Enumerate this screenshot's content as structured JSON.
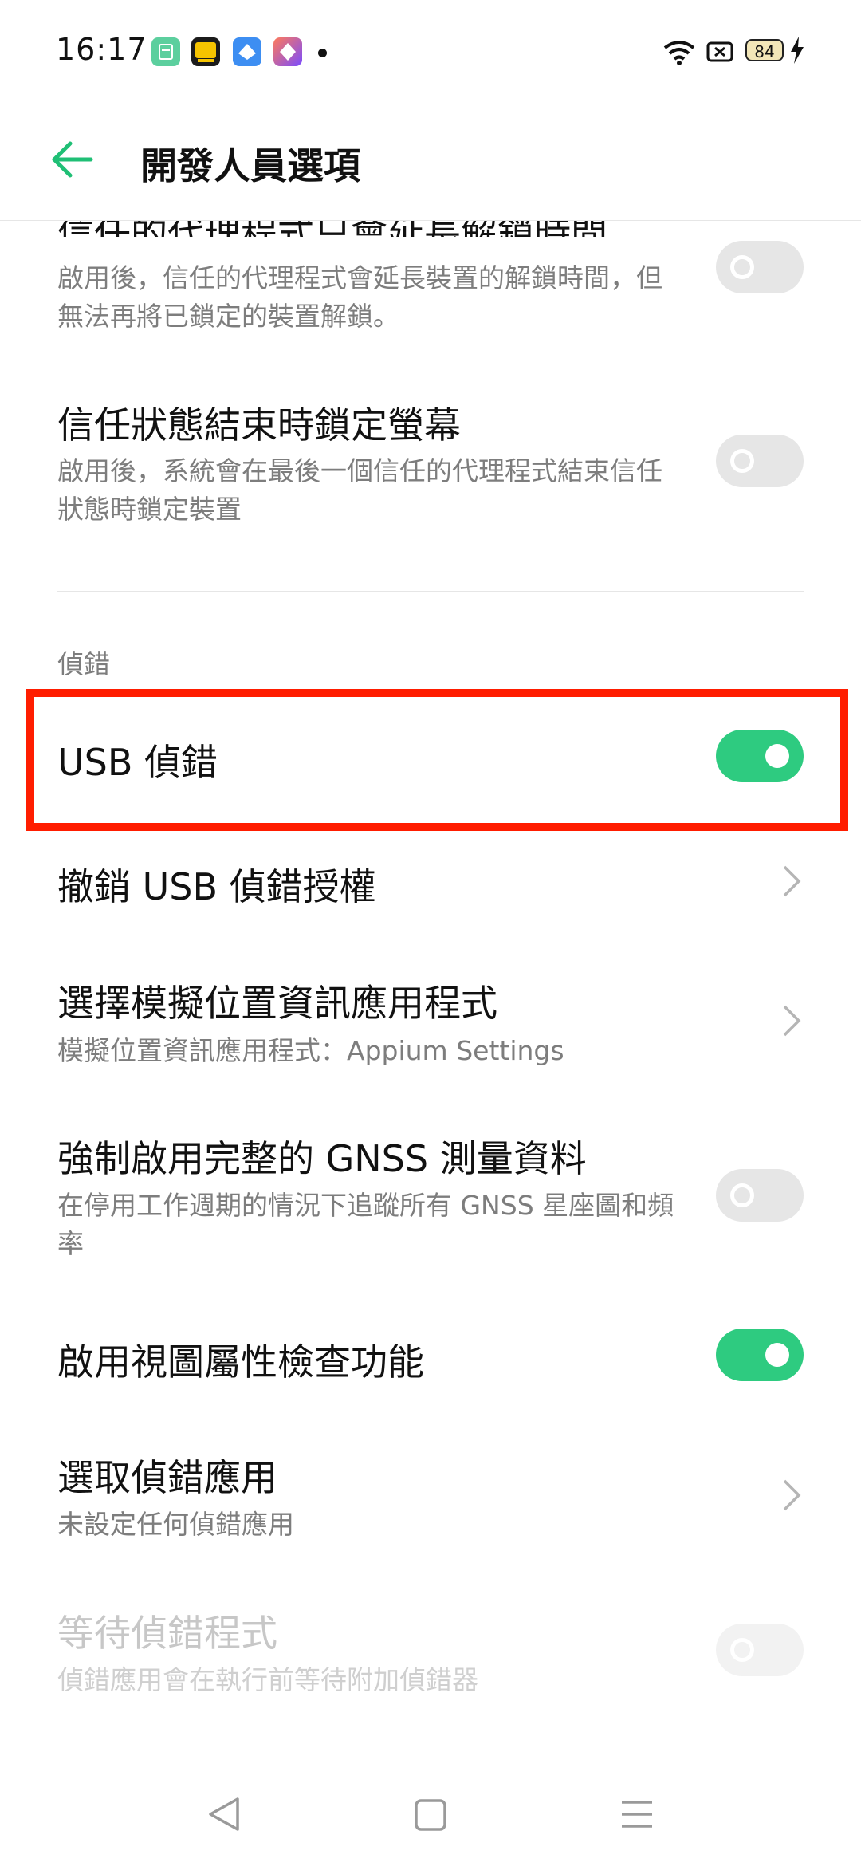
{
  "status_bar": {
    "time": "16:17",
    "battery_level": "84",
    "icons": [
      "app-icon-green",
      "soup-app-icon",
      "blue-diamond-app-icon",
      "purple-app-icon",
      "notification-dot",
      "wifi-icon",
      "sim-error-icon",
      "battery-icon",
      "charging-icon"
    ]
  },
  "app_bar": {
    "title": "開發人員選項",
    "back_icon": "back-arrow-icon",
    "accent": "#1fbf75"
  },
  "settings": {
    "trust_agent": {
      "title": "信任的代理程式只會延長解鎖時間",
      "subtitle": "啟用後，信任的代理程式會延長裝置的解鎖時間，但無法再將已鎖定的裝置解鎖。",
      "enabled": false
    },
    "lock_on_trust_lost": {
      "title": "信任狀態結束時鎖定螢幕",
      "subtitle": "啟用後，系統會在最後一個信任的代理程式結束信任狀態時鎖定裝置",
      "enabled": false
    },
    "section_debug": "偵錯",
    "usb_debugging": {
      "title": "USB 偵錯",
      "enabled": true
    },
    "revoke_usb": {
      "title": "撤銷 USB 偵錯授權"
    },
    "mock_location": {
      "title": "選擇模擬位置資訊應用程式",
      "subtitle": "模擬位置資訊應用程式：Appium Settings"
    },
    "gnss": {
      "title": "強制啟用完整的 GNSS 測量資料",
      "subtitle": "在停用工作週期的情況下追蹤所有 GNSS 星座圖和頻率",
      "enabled": false
    },
    "view_attr": {
      "title": "啟用視圖屬性檢查功能",
      "enabled": true
    },
    "debug_app": {
      "title": "選取偵錯應用",
      "subtitle": "未設定任何偵錯應用"
    },
    "wait_debugger": {
      "title": "等待偵錯程式",
      "subtitle": "偵錯應用會在執行前等待附加偵錯器",
      "enabled": false
    }
  },
  "colors": {
    "toggle_on": "#2ecb80",
    "toggle_off": "#e6e6e6",
    "highlight": "#ff1d00"
  },
  "nav_bar": {
    "icons": [
      "back-triangle-icon",
      "home-square-icon",
      "menu-lines-icon"
    ]
  }
}
